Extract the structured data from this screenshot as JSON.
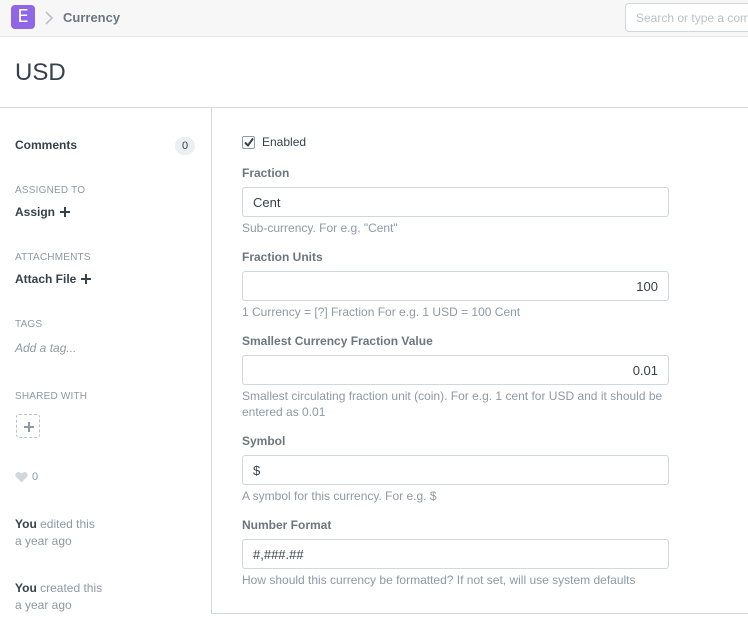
{
  "navbar": {
    "logo_letter": "E",
    "breadcrumb": "Currency",
    "search_placeholder": "Search or type a command"
  },
  "page": {
    "title": "USD"
  },
  "sidebar": {
    "comments_label": "Comments",
    "comments_count": "0",
    "assigned_to_label": "ASSIGNED TO",
    "assign_label": "Assign",
    "attachments_label": "ATTACHMENTS",
    "attach_label": "Attach File",
    "tags_label": "TAGS",
    "add_tag_label": "Add a tag...",
    "shared_with_label": "SHARED WITH",
    "likes_count": "0",
    "timeline": [
      {
        "user": "You",
        "action": " edited this",
        "time": "a year ago"
      },
      {
        "user": "You",
        "action": " created this",
        "time": "a year ago"
      }
    ]
  },
  "form": {
    "enabled_label": "Enabled",
    "enabled_checked": true,
    "fraction": {
      "label": "Fraction",
      "value": "Cent",
      "help": "Sub-currency. For e.g. \"Cent\""
    },
    "fraction_units": {
      "label": "Fraction Units",
      "value": "100",
      "help": "1 Currency = [?] Fraction For e.g. 1 USD = 100 Cent"
    },
    "smallest_fraction": {
      "label": "Smallest Currency Fraction Value",
      "value": "0.01",
      "help": "Smallest circulating fraction unit (coin). For e.g. 1 cent for USD and it should be entered as 0.01"
    },
    "symbol": {
      "label": "Symbol",
      "value": "$",
      "help": "A symbol for this currency. For e.g. $"
    },
    "number_format": {
      "label": "Number Format",
      "value": "#,###.##",
      "help": "How should this currency be formatted? If not set, will use system defaults"
    }
  },
  "colors": {
    "brand": "#8e66e6",
    "text": "#36414c",
    "muted": "#8d99a6",
    "border": "#d1d8dd"
  },
  "icons": {
    "logo": "app-logo-icon",
    "breadcrumb_separator": "chevron-right-icon",
    "add": "plus-icon",
    "like": "heart-icon",
    "check": "check-icon"
  }
}
